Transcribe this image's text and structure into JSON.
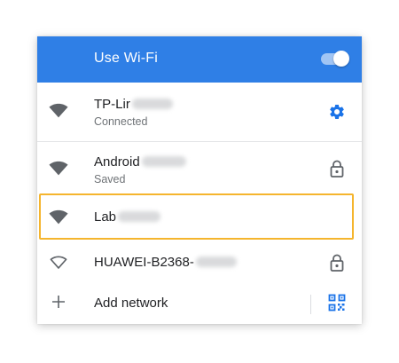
{
  "header": {
    "title": "Use Wi-Fi",
    "toggle_on": true
  },
  "networks": [
    {
      "ssid": "TP-Lir",
      "status": "Connected",
      "signal": "full",
      "trailing_icon": "gear-icon"
    },
    {
      "ssid": "Android",
      "status": "Saved",
      "signal": "full",
      "trailing_icon": "lock-icon"
    },
    {
      "ssid": "Lab",
      "status": "",
      "signal": "full",
      "trailing_icon": ""
    },
    {
      "ssid": "HUAWEI-B2368-",
      "status": "",
      "signal": "outline",
      "trailing_icon": "lock-icon"
    }
  ],
  "add_network": {
    "label": "Add network",
    "icon": "plus-icon",
    "trailing_icon": "qr-code-icon"
  },
  "colors": {
    "header_bg": "#2f7fe6",
    "accent_blue": "#1a73e8",
    "highlight": "#f5b52e",
    "icon_gray": "#5f6368"
  }
}
